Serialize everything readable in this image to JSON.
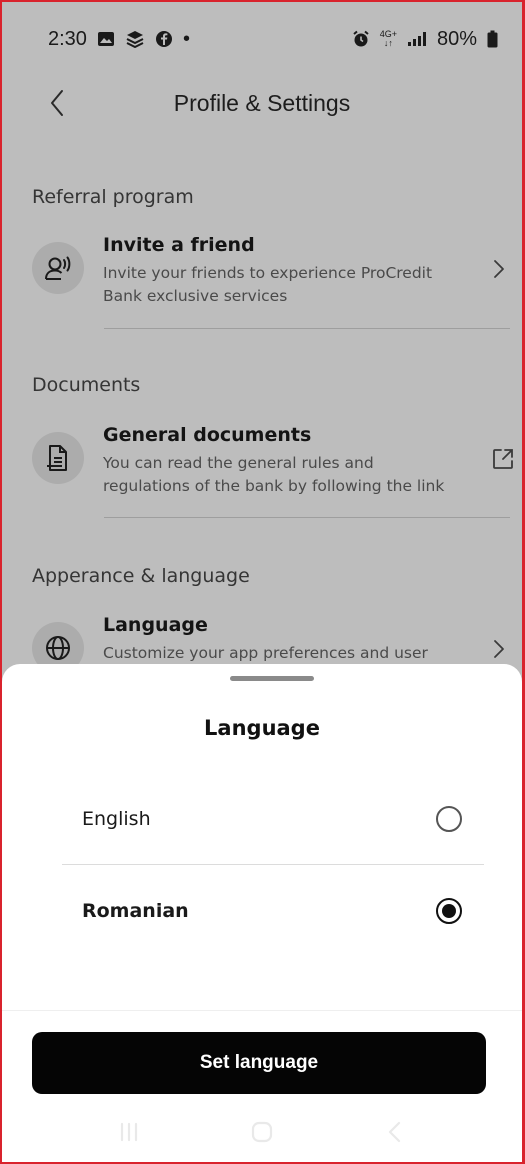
{
  "status_bar": {
    "time": "2:30",
    "dot": "•",
    "network_top": "4G+",
    "network_bottom": "↓↑",
    "battery": "80%",
    "icons": [
      "gallery-icon",
      "stack-icon",
      "facebook-icon",
      "alarm-icon",
      "signal-icon",
      "battery-icon"
    ]
  },
  "header": {
    "title": "Profile & Settings",
    "back_icon": "chevron-left-icon"
  },
  "sections": [
    {
      "label": "Referral program",
      "item": {
        "title": "Invite a friend",
        "description": "Invite your friends to experience ProCredit Bank exclusive services",
        "icon": "invite-person-icon",
        "action_icon": "chevron-right-icon"
      }
    },
    {
      "label": "Documents",
      "item": {
        "title": "General documents",
        "description": "You can read the general rules and regulations of the bank by following the link",
        "icon": "document-icon",
        "action_icon": "external-link-icon"
      }
    },
    {
      "label": "Apperance & language",
      "item": {
        "title": "Language",
        "description": "Customize your app preferences   and user",
        "icon": "globe-icon",
        "action_icon": "chevron-right-icon"
      }
    }
  ],
  "sheet": {
    "title": "Language",
    "options": [
      {
        "label": "English",
        "selected": false
      },
      {
        "label": "Romanian",
        "selected": true
      }
    ],
    "button_label": "Set language"
  },
  "nav_bar": {
    "icons": [
      "recent-apps-icon",
      "home-icon",
      "back-icon"
    ]
  },
  "colors": {
    "overlay": "#bdbdbd",
    "button": "#050505",
    "frame_border": "#d9232d"
  }
}
